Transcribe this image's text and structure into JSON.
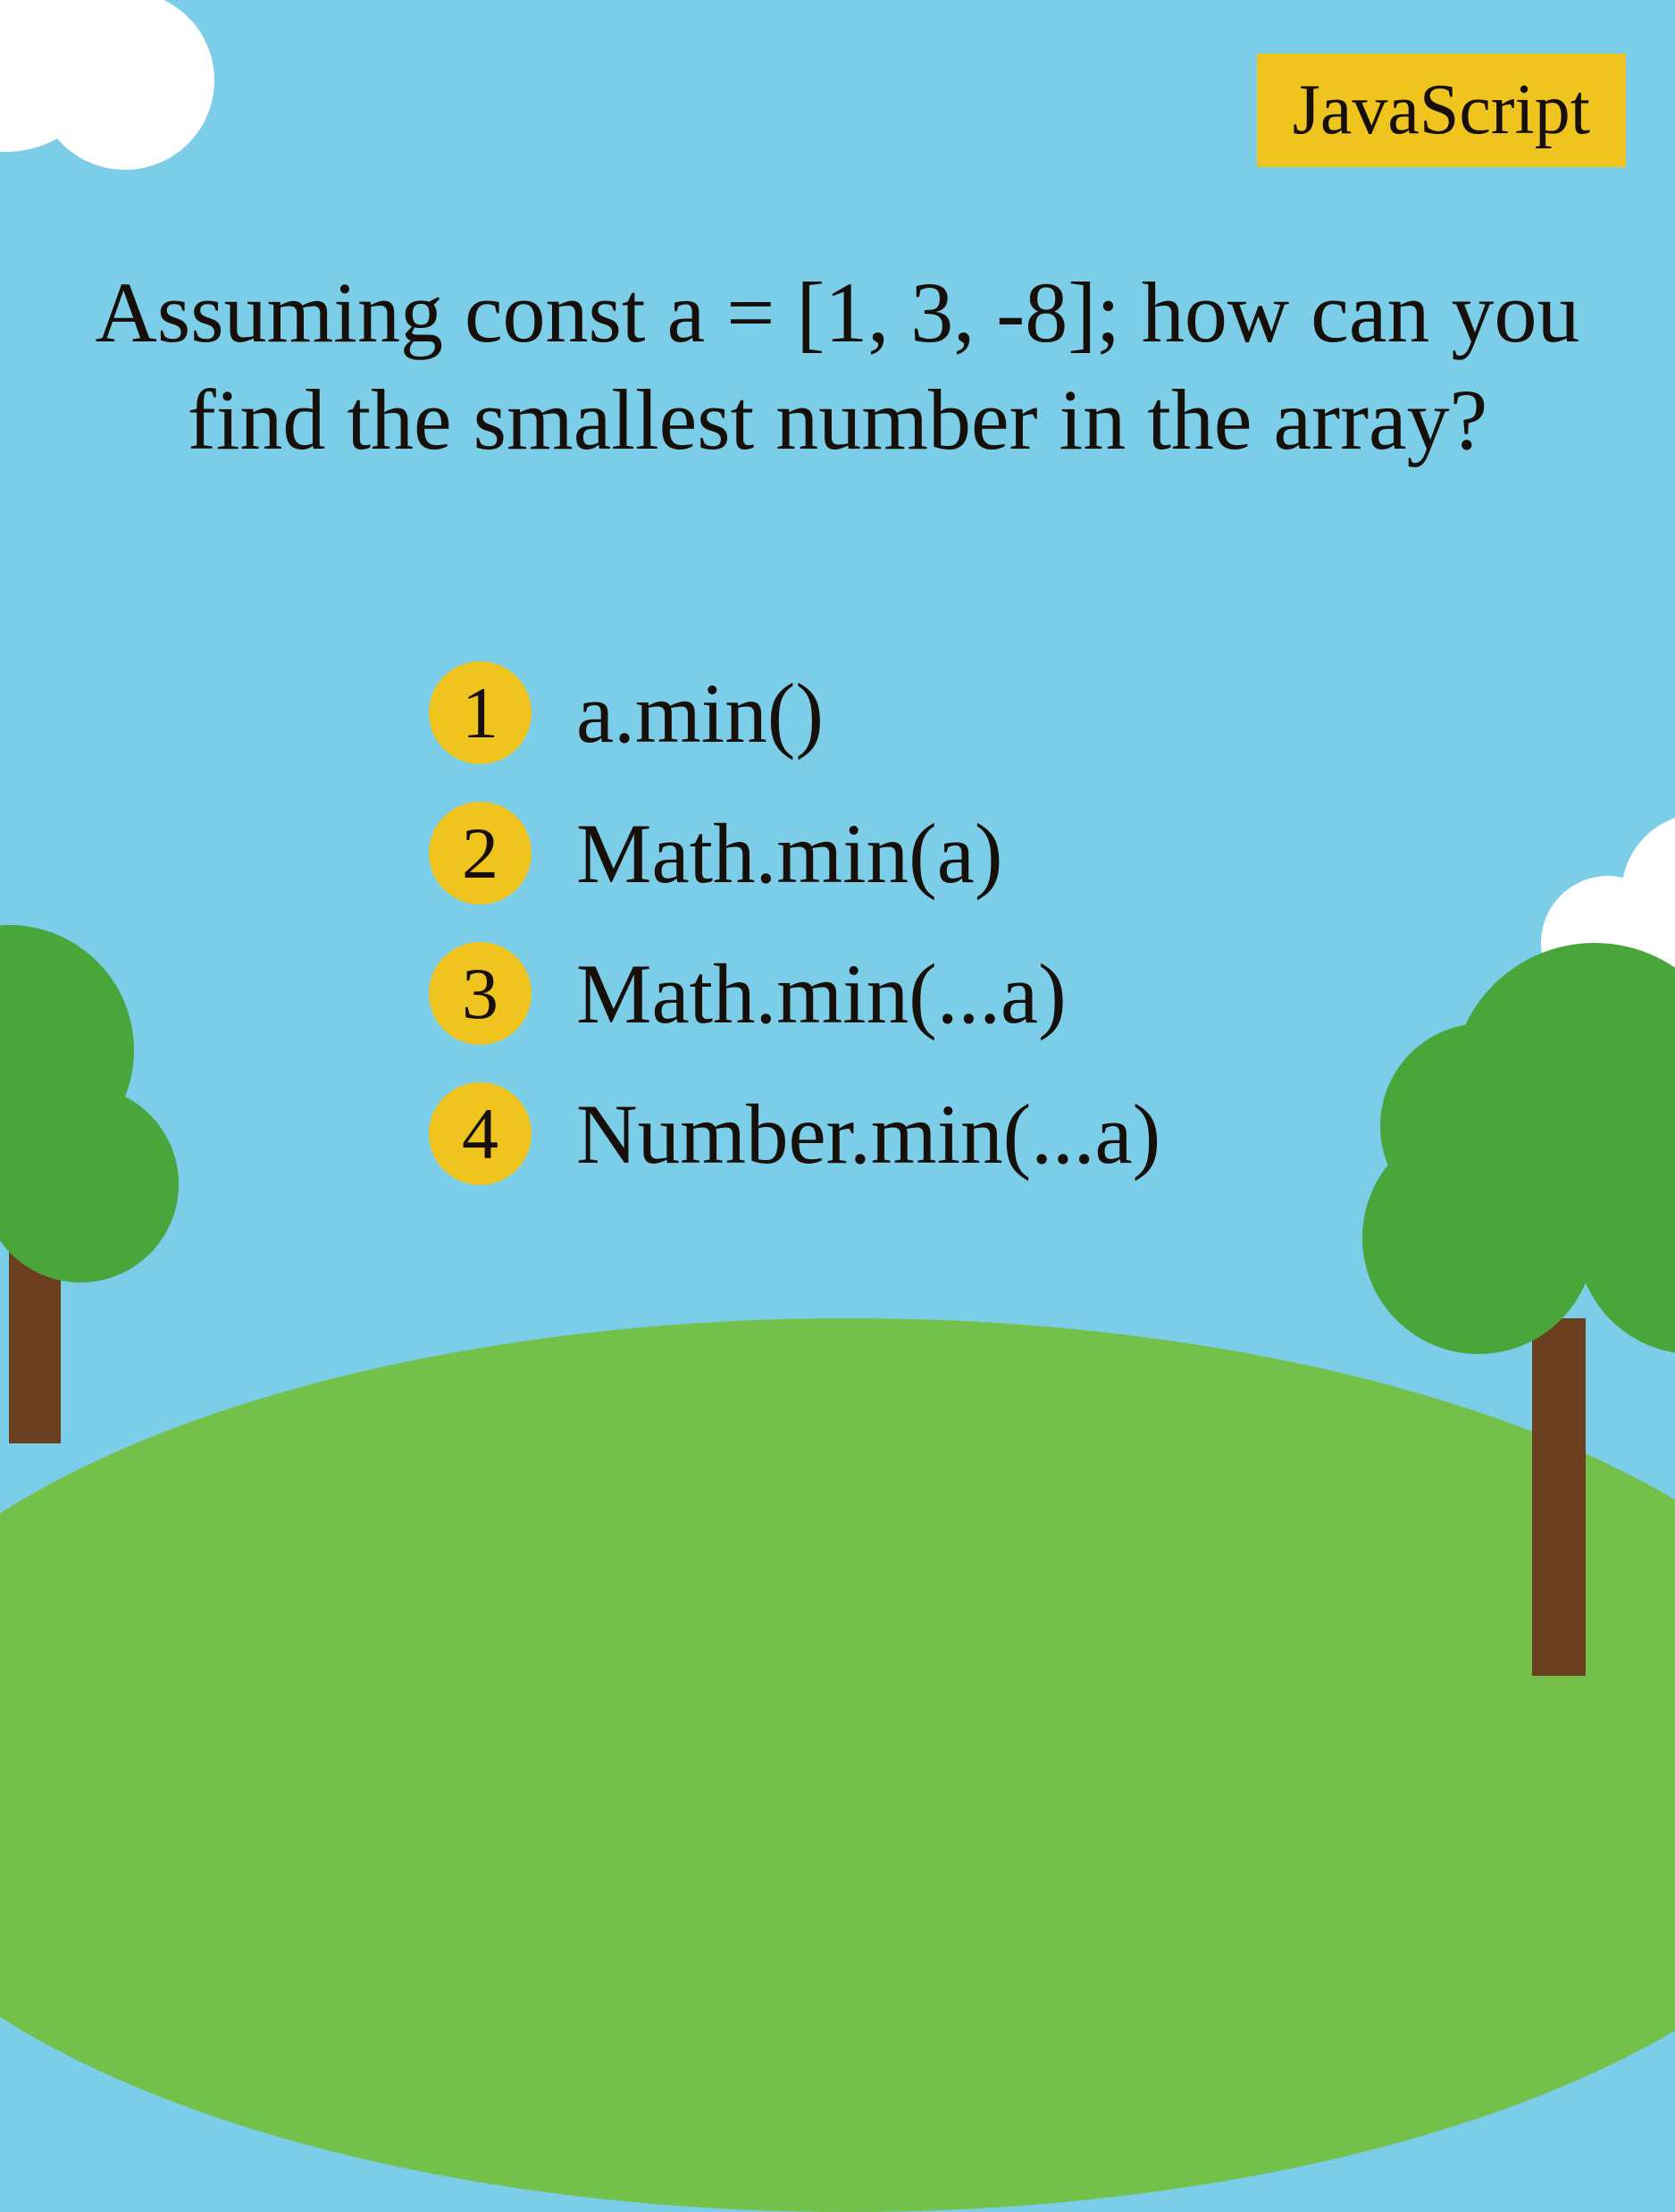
{
  "badge": "JavaScript",
  "question": "Assuming const a = [1, 3, -8]; how can you find the smallest number in the array?",
  "options": [
    {
      "num": "1",
      "text": "a.min()"
    },
    {
      "num": "2",
      "text": "Math.min(a)"
    },
    {
      "num": "3",
      "text": "Math.min(...a)"
    },
    {
      "num": "4",
      "text": "Number.min(...a)"
    }
  ],
  "colors": {
    "sky": "#7BCDE8",
    "grass": "#73C04A",
    "tree": "#4AA53A",
    "trunk": "#6B3E1F",
    "accent": "#F0C41F",
    "text": "#17100A"
  }
}
